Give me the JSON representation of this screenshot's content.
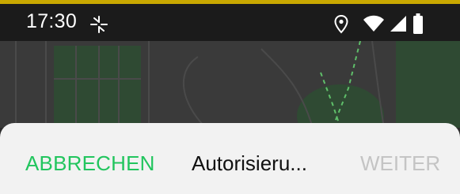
{
  "status_bar": {
    "time": "17:30",
    "icons": [
      "fan-icon",
      "location-pin-icon",
      "wifi-icon",
      "cellular-signal-icon",
      "battery-icon"
    ]
  },
  "map": {
    "background_color": "#3a3a3a",
    "feature_color": "#2f4a33"
  },
  "sheet": {
    "cancel_label": "ABBRECHEN",
    "title": "Autorisieru...",
    "next_label": "WEITER"
  },
  "colors": {
    "accent_strip": "#c9a800",
    "status_bar_bg": "#1b1b1b",
    "cancel_text": "#22c55e",
    "title_text": "#111111",
    "disabled_text": "#c4c4c4",
    "sheet_bg": "#f2f2f2"
  }
}
